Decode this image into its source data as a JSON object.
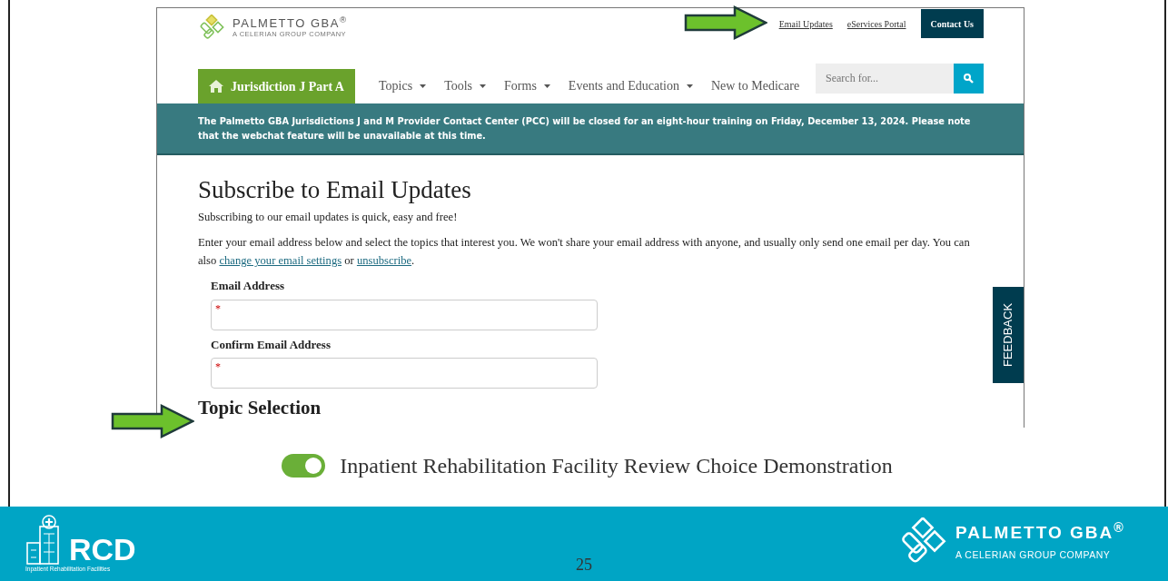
{
  "site": {
    "logo_name": "PALMETTO GBA",
    "logo_mark": "®",
    "logo_tagline": "A CELERIAN GROUP COMPANY"
  },
  "top_links": [
    {
      "label": "Email Updates",
      "kind": "link"
    },
    {
      "label": "eServices Portal",
      "kind": "link"
    },
    {
      "label": "Contact Us",
      "kind": "button"
    }
  ],
  "nav": {
    "home": "Jurisdiction J Part A",
    "items": [
      {
        "label": "Topics",
        "dropdown": true
      },
      {
        "label": "Tools",
        "dropdown": true
      },
      {
        "label": "Forms",
        "dropdown": true
      },
      {
        "label": "Events and Education",
        "dropdown": true
      },
      {
        "label": "New to Medicare",
        "dropdown": false
      }
    ]
  },
  "search": {
    "placeholder": "Search for..."
  },
  "banner": "The Palmetto GBA Jurisdictions J and M Provider Contact Center (PCC) will be closed for an eight-hour training on Friday, December 13, 2024. Please note that the webchat feature will be unavailable at this time.",
  "page": {
    "title": "Subscribe to Email Updates",
    "intro": "Subscribing to our email updates is quick, easy and free!",
    "paragraph": [
      {
        "text": "Enter your email address below and select the topics that interest you. We won't share your email address with anyone, and usually only send one email per day. You can also ",
        "kind": "text"
      },
      {
        "text": "change your email settings",
        "kind": "link"
      },
      {
        "text": " or ",
        "kind": "text"
      },
      {
        "text": "unsubscribe",
        "kind": "link"
      },
      {
        "text": ".",
        "kind": "text"
      }
    ],
    "fields": [
      {
        "label": "Email Address",
        "required": true,
        "required_mark": "*"
      },
      {
        "label": "Confirm Email Address",
        "required": true,
        "required_mark": "*"
      }
    ],
    "topic_heading": "Topic Selection"
  },
  "feedback": "FEEDBACK",
  "topics": [
    {
      "label": "Inpatient Rehabilitation Facility Review Choice Demonstration",
      "on": true
    }
  ],
  "footer": {
    "rcd": "RCD",
    "rcd_caption": "Inpatient Rehabilitation Facilities",
    "page_number": "25",
    "logo_name": "PALMETTO GBA",
    "logo_mark": "®",
    "logo_tagline": "A CELERIAN GROUP COMPANY"
  }
}
